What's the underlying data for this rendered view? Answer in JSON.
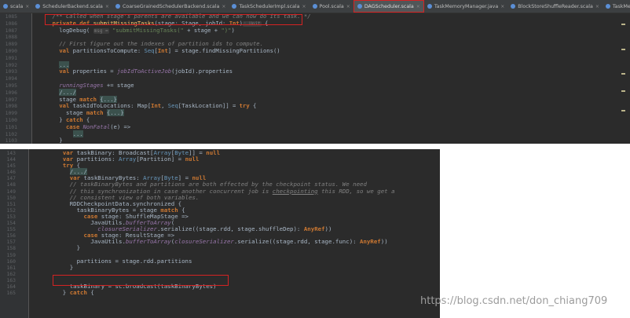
{
  "top_tabs": [
    {
      "label": "scala",
      "active": false
    },
    {
      "label": "SchedulerBackend.scala",
      "active": false
    },
    {
      "label": "CoarseGrainedSchedulerBackend.scala",
      "active": false
    },
    {
      "label": "TaskSchedulerImpl.scala",
      "active": false
    },
    {
      "label": "Pool.scala",
      "active": false
    },
    {
      "label": "DAGScheduler.scala",
      "active": true
    },
    {
      "label": "TaskMemoryManager.java",
      "active": false
    },
    {
      "label": "BlockStoreShuffleReader.scala",
      "active": false
    },
    {
      "label": "TaskMetrics.scala",
      "active": false
    }
  ],
  "top_code": [
    {
      "n": "1085",
      "html": "  <span class=\"c\">/** Called when stage's parents are available and we can now do its task. */</span>"
    },
    {
      "n": "1086",
      "html": "  <span class=\"k\">private def</span> <span class=\"f\">submitMissingTasks</span>(stage: Stage, jobId: <span class=\"k\">Int</span>)<span class=\"hint\">: Unit</span> {"
    },
    {
      "n": "1087",
      "html": "    logDebug( <span class=\"hint\">msg =</span> <span class=\"s\">\"submitMissingTasks(\"</span> + stage + <span class=\"s\">\")\"</span>)"
    },
    {
      "n": "1088",
      "html": ""
    },
    {
      "n": "1089",
      "html": "    <span class=\"c\">// First figure out the indexes of partition ids to compute.</span>"
    },
    {
      "n": "1090",
      "html": "    <span class=\"k\">val</span> partitionsToCompute: <span class=\"t\">Seq</span>[<span class=\"k\">Int</span>] = stage.findMissingPartitions()"
    },
    {
      "n": "1091",
      "html": ""
    },
    {
      "n": "1092",
      "html": "    <span class=\"fold\">...</span>"
    },
    {
      "n": "1093",
      "html": "    <span class=\"k\">val</span> properties = <span class=\"i\">jobIdToActiveJob</span>(jobId).properties"
    },
    {
      "n": "1094",
      "html": ""
    },
    {
      "n": "1095",
      "html": "    <span class=\"i\">runningStages</span> += stage"
    },
    {
      "n": "1096",
      "html": "    <span class=\"fold\">/.../</span>"
    },
    {
      "n": "1097",
      "html": "    stage <span class=\"k\">match</span> <span class=\"fold\">{...}</span>"
    },
    {
      "n": "1098",
      "html": "    <span class=\"k\">val</span> taskIdToLocations: Map[<span class=\"k\">Int</span>, <span class=\"t\">Seq</span>[TaskLocation]] = <span class=\"k\">try</span> {"
    },
    {
      "n": "1099",
      "html": "      stage <span class=\"k\">match</span> <span class=\"fold\">{...}</span>"
    },
    {
      "n": "1100",
      "html": "    } <span class=\"k\">catch</span> {"
    },
    {
      "n": "1101",
      "html": "      <span class=\"k\">case</span> <span class=\"i\">NonFatal</span>(e) =>"
    },
    {
      "n": "1102",
      "html": "        <span class=\"fold\">...</span>"
    },
    {
      "n": "1103",
      "html": "    }"
    },
    {
      "n": "1104",
      "html": ""
    },
    {
      "n": "1105",
      "html": "    stage.makeNewStageAttempt(partitionsToCompute.size, taskIdToLocations.values.toSeq)"
    },
    {
      "n": "1106",
      "html": ""
    }
  ],
  "bottom_code": [
    {
      "n": "143",
      "html": "    <span class=\"k\">var</span> taskBinary: Broadcast[<span class=\"t\">Array</span>[<span class=\"t\">Byte</span>]] = <span class=\"k\">null</span>"
    },
    {
      "n": "144",
      "html": "    <span class=\"k\">var</span> partitions: <span class=\"t\">Array</span>[Partition] = <span class=\"k\">null</span>"
    },
    {
      "n": "145",
      "html": "    <span class=\"k\">try</span> {"
    },
    {
      "n": "146",
      "html": "      <span class=\"fold\">/.../</span>"
    },
    {
      "n": "147",
      "html": "      <span class=\"k\">var</span> taskBinaryBytes: <span class=\"t\">Array</span>[<span class=\"t\">Byte</span>] = <span class=\"k\">null</span>"
    },
    {
      "n": "148",
      "html": "      <span class=\"c\">// taskBinaryBytes and partitions are both effected by the checkpoint status. We need</span>"
    },
    {
      "n": "149",
      "html": "      <span class=\"c\">// this synchronization in case another concurrent job is <span class=\"ul\">checkpointing</span> this RDD, so we get a</span>"
    },
    {
      "n": "150",
      "html": "      <span class=\"c\">// consistent view of both variables.</span>"
    },
    {
      "n": "151",
      "html": "      RDDCheckpointData.synchronized {"
    },
    {
      "n": "152",
      "html": "        taskBinaryBytes = stage <span class=\"k\">match</span> {"
    },
    {
      "n": "153",
      "html": "          <span class=\"k\">case</span> stage: ShuffleMapStage =>"
    },
    {
      "n": "154",
      "html": "            JavaUtils.<span class=\"i\">bufferToArray</span>("
    },
    {
      "n": "155",
      "html": "              <span class=\"i\">closureSerializer</span>.serialize((stage.rdd, stage.shuffleDep): <span class=\"k\">AnyRef</span>))"
    },
    {
      "n": "156",
      "html": "          <span class=\"k\">case</span> stage: ResultStage =>"
    },
    {
      "n": "157",
      "html": "            JavaUtils.<span class=\"i\">bufferToArray</span>(<span class=\"i\">closureSerializer</span>.serialize((stage.rdd, stage.func): <span class=\"k\">AnyRef</span>))"
    },
    {
      "n": "158",
      "html": "        }"
    },
    {
      "n": "159",
      "html": ""
    },
    {
      "n": "160",
      "html": "        partitions = stage.rdd.partitions"
    },
    {
      "n": "161",
      "html": "      }"
    },
    {
      "n": "162",
      "html": ""
    },
    {
      "n": "163",
      "html": ""
    },
    {
      "n": "164",
      "html": "      taskBinary = sc.broadcast(taskBinaryBytes)"
    },
    {
      "n": "165",
      "html": "    } <span class=\"k\">catch</span> {"
    }
  ],
  "watermark": "https://blog.csdn.net/don_chiang709"
}
